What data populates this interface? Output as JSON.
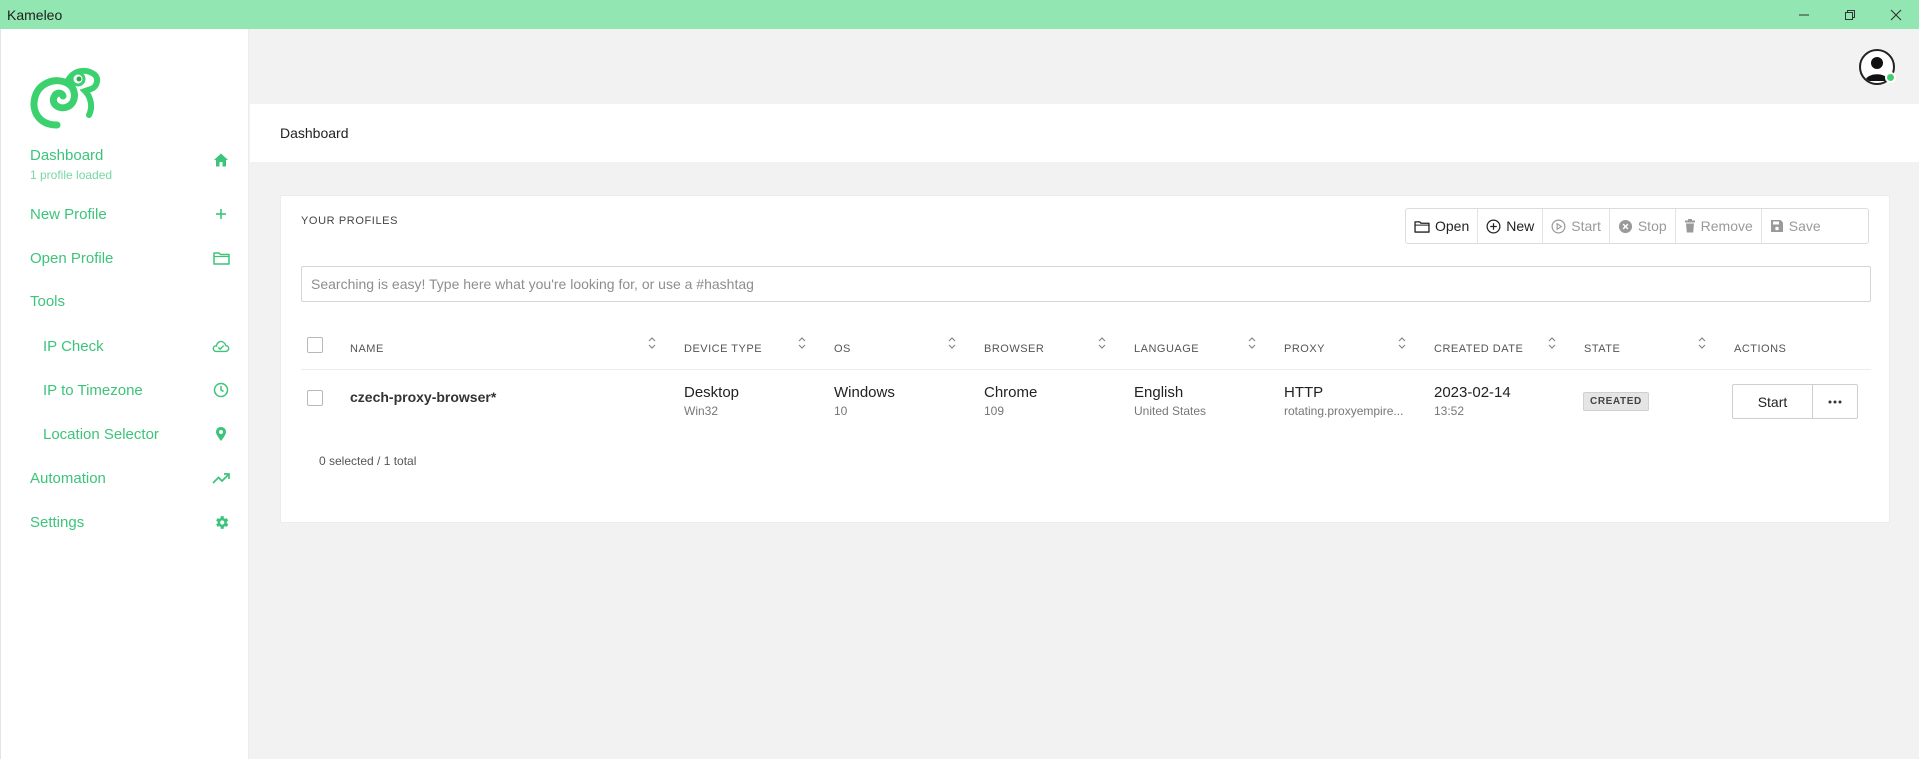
{
  "window": {
    "title": "Kameleo",
    "controls": [
      "minimize-icon",
      "restore-icon",
      "close-icon"
    ]
  },
  "colors": {
    "titlebar": "#92e6b1",
    "accent": "#3cc47a",
    "online": "#3fcf6d"
  },
  "sidebar": {
    "items": [
      {
        "label": "Dashboard",
        "sublabel": "1 profile loaded",
        "icon": "home-icon"
      },
      {
        "label": "New Profile",
        "icon": "plus-icon"
      },
      {
        "label": "Open Profile",
        "icon": "folder-icon"
      },
      {
        "label": "Tools"
      },
      {
        "label": "IP Check",
        "icon": "cloud-check-icon"
      },
      {
        "label": "IP to Timezone",
        "icon": "clock-icon"
      },
      {
        "label": "Location Selector",
        "icon": "location-pin-icon"
      },
      {
        "label": "Automation",
        "icon": "trending-up-icon"
      },
      {
        "label": "Settings",
        "icon": "gear-icon"
      }
    ]
  },
  "header": {
    "breadcrumb": "Dashboard",
    "user_status": "online"
  },
  "profiles": {
    "title": "YOUR PROFILES",
    "toolbar": [
      {
        "label": "Open",
        "icon": "folder-icon",
        "enabled": true
      },
      {
        "label": "New",
        "icon": "plus-circle-icon",
        "enabled": true
      },
      {
        "label": "Start",
        "icon": "play-circle-icon",
        "enabled": false
      },
      {
        "label": "Stop",
        "icon": "stop-circle-icon",
        "enabled": false
      },
      {
        "label": "Remove",
        "icon": "trash-icon",
        "enabled": false
      },
      {
        "label": "Save",
        "icon": "save-icon",
        "enabled": false
      }
    ],
    "search": {
      "placeholder": "Searching is easy! Type here what you're looking for, or use a #hashtag",
      "value": ""
    },
    "columns": [
      "NAME",
      "DEVICE TYPE",
      "OS",
      "BROWSER",
      "LANGUAGE",
      "PROXY",
      "CREATED DATE",
      "STATE",
      "ACTIONS"
    ],
    "rows": [
      {
        "name": "czech-proxy-browser*",
        "device_type": "Desktop",
        "device_sub": "Win32",
        "os": "Windows",
        "os_sub": "10",
        "browser": "Chrome",
        "browser_sub": "109",
        "language": "English",
        "language_sub": "United States",
        "proxy": "HTTP",
        "proxy_sub": "rotating.proxyempire...",
        "created_date": "2023-02-14",
        "created_time": "13:52",
        "state": "CREATED",
        "action_label": "Start"
      }
    ],
    "footer": "0 selected / 1 total"
  }
}
